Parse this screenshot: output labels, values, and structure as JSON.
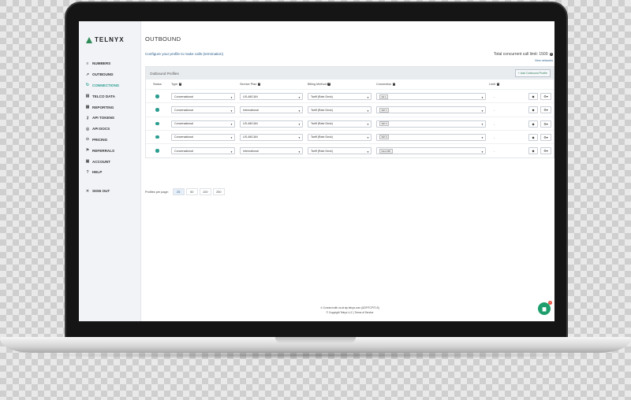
{
  "brand": {
    "logo_text": "TELNYX",
    "accent": "#2a9d8f",
    "logo_color": "#2e8b57"
  },
  "sidebar": {
    "items": [
      {
        "label": "NUMBERS",
        "icon": "list-icon",
        "active": false
      },
      {
        "label": "OUTBOUND",
        "icon": "outbound-icon",
        "active": false
      },
      {
        "label": "CONNECTIONS",
        "icon": "connections-icon",
        "active": true
      },
      {
        "label": "TELCO DATA",
        "icon": "data-icon",
        "active": false
      },
      {
        "label": "REPORTING",
        "icon": "report-icon",
        "active": false
      },
      {
        "label": "API TOKENS",
        "icon": "key-icon",
        "active": false
      },
      {
        "label": "API DOCS",
        "icon": "docs-icon",
        "active": false
      },
      {
        "label": "PRICING",
        "icon": "pricing-icon",
        "active": false
      },
      {
        "label": "REFERRALS",
        "icon": "referrals-icon",
        "active": false
      },
      {
        "label": "ACCOUNT",
        "icon": "account-icon",
        "active": false
      },
      {
        "label": "HELP",
        "icon": "help-icon",
        "active": false
      }
    ],
    "signout": {
      "label": "SIGN OUT",
      "icon": "close-icon"
    }
  },
  "header": {
    "title": "OUTBOUND",
    "subtitle": "Configure your profile to make calls (termination)",
    "limit_text": "Total concurrent call limit: 1500",
    "view_networks": "View networks"
  },
  "panel": {
    "title": "Outbound Profiles",
    "add_button": "+ Add Outbound Profile",
    "columns": [
      "Status",
      "Type",
      "Service Plan",
      "Billing Method",
      "Connection",
      "Limit"
    ],
    "rows": [
      {
        "type": "Conversational",
        "plan": "US-48/CAN",
        "billing": "Tariff (Rate Deck)",
        "connection": "Sd 1",
        "limit": "-"
      },
      {
        "type": "Conversational",
        "plan": "International",
        "billing": "Tariff (Rate Deck)",
        "connection": "SIP 1",
        "limit": "-"
      },
      {
        "type": "Conversational",
        "plan": "US-48/CAN",
        "billing": "Tariff (Rate Deck)",
        "connection": "SIP 2",
        "limit": "-"
      },
      {
        "type": "Conversational",
        "plan": "US-48/CAN",
        "billing": "Tariff (Rate Deck)",
        "connection": "SIP 3",
        "limit": "-"
      },
      {
        "type": "Conversational",
        "plan": "International",
        "billing": "Tariff (Rate Deck)",
        "connection": "New FBI",
        "limit": "-"
      }
    ]
  },
  "pager": {
    "label": "Profiles per page:",
    "options": [
      "25",
      "50",
      "100",
      "250"
    ],
    "selected": "25"
  },
  "footer": {
    "line1": "Connect with us at sip.telnyx.com (UDP/TCP/TLS)",
    "line2": "© Copyright Telnyx LLC | Terms of Service"
  },
  "chat": {
    "badge": "1"
  }
}
